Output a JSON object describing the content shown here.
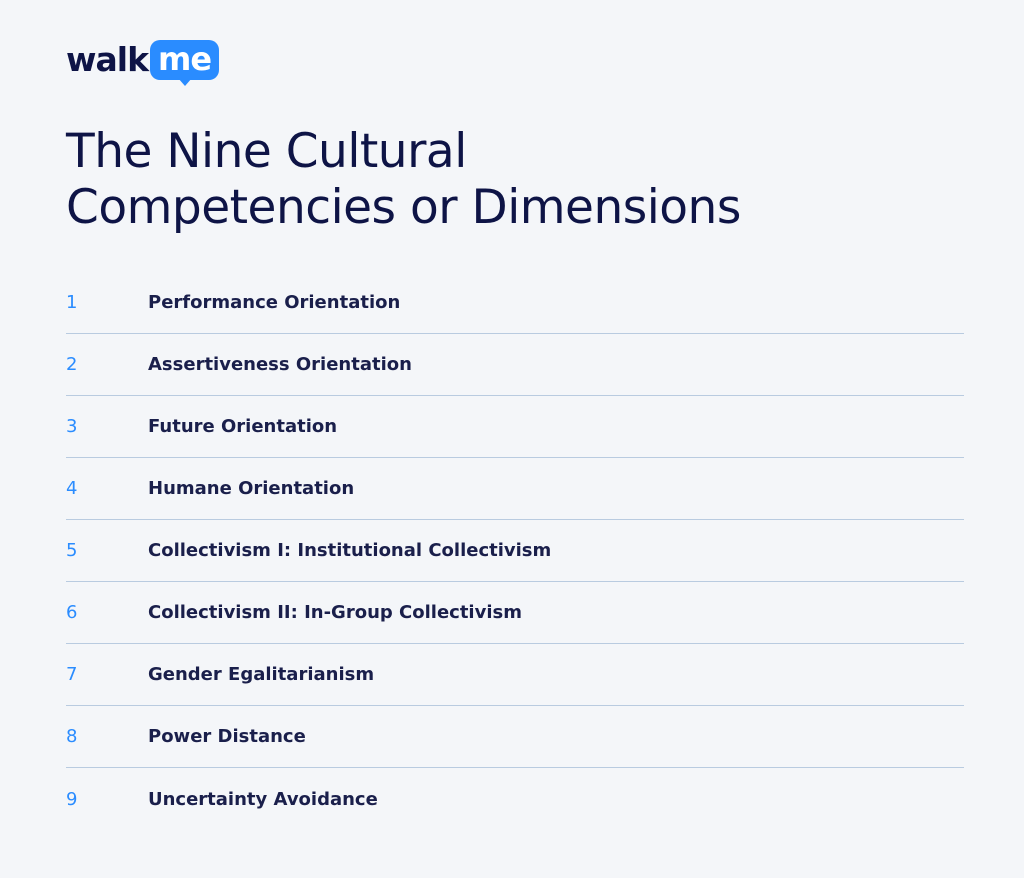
{
  "logo": {
    "walk": "walk",
    "me": "me"
  },
  "title": {
    "line1": "The Nine Cultural",
    "line2": "Competencies or Dimensions"
  },
  "items": [
    {
      "number": "1",
      "label": "Performance Orientation"
    },
    {
      "number": "2",
      "label": "Assertiveness Orientation"
    },
    {
      "number": "3",
      "label": "Future Orientation"
    },
    {
      "number": "4",
      "label": "Humane Orientation"
    },
    {
      "number": "5",
      "label": "Collectivism I: Institutional Collectivism"
    },
    {
      "number": "6",
      "label": "Collectivism II: In-Group Collectivism"
    },
    {
      "number": "7",
      "label": "Gender Egalitarianism"
    },
    {
      "number": "8",
      "label": "Power Distance"
    },
    {
      "number": "9",
      "label": "Uncertainty Avoidance"
    }
  ],
  "colors": {
    "background": "#f4f6f9",
    "accent": "#2a8cff",
    "text": "#1a1f4b",
    "divider": "#b9cbe0"
  }
}
